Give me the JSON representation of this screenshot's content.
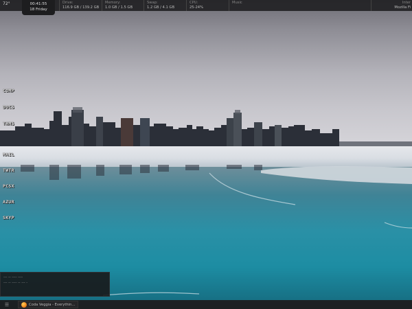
{
  "top_panel": {
    "weather": "72°",
    "clock": {
      "time": "00:41:55",
      "date": "18 Friday"
    },
    "drive": {
      "label": "Drive:",
      "value": "116.9 GB / 139.2 GB"
    },
    "memory": {
      "label": "Memory:",
      "value": "1.0 GB    / 1.5 GB"
    },
    "swap": {
      "label": "Swap:",
      "value": "1.2 GB    / 4.1 GB"
    },
    "cpu": {
      "label": "CPU:",
      "value": "25-24%"
    },
    "music": {
      "label": "Music"
    },
    "right": {
      "line1": "Inter",
      "line2": "Mozilla Fi"
    }
  },
  "launchers": [
    "COMP",
    "DOCS",
    "THMS",
    "MAIL",
    "TWTR",
    "PCSX",
    "AZUR",
    "SKYP"
  ],
  "widget": {
    "line1": "--- -- ---- ----",
    "line2": "--- -- ---- -- --- -"
  },
  "taskbar": {
    "menu_icon": "menu-icon",
    "task_label": "Coda Veggia - Everythin..."
  },
  "colors": {
    "panel": "#1e1e20",
    "water": "#1d8da3",
    "sky": "#b4b3ba"
  }
}
